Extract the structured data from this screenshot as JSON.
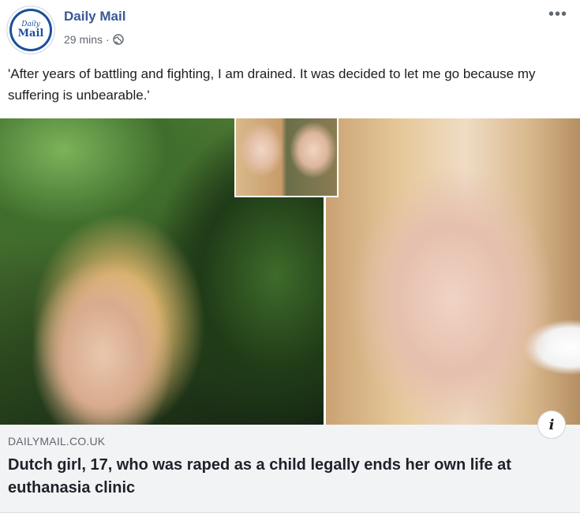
{
  "post": {
    "page_name": "Daily Mail",
    "avatar_logo_top": "Daily",
    "avatar_logo_bottom": "Mail",
    "timestamp": "29 mins",
    "separator": "·",
    "privacy_icon": "globe-icon",
    "more_icon": "more-options-icon",
    "more_label": "•••",
    "text": "'After years of battling and fighting, I am drained. It was decided to let me go because my suffering is unbearable.'"
  },
  "link_preview": {
    "info_icon": "info-icon",
    "info_label": "i",
    "domain": "DAILYMAIL.CO.UK",
    "headline": "Dutch girl, 17, who was raped as a child legally ends her own life at euthanasia clinic"
  },
  "colors": {
    "page_name": "#385898",
    "meta_text": "#606770",
    "caption_background": "#f2f3f5",
    "avatar_brand": "#1b4f9c"
  }
}
